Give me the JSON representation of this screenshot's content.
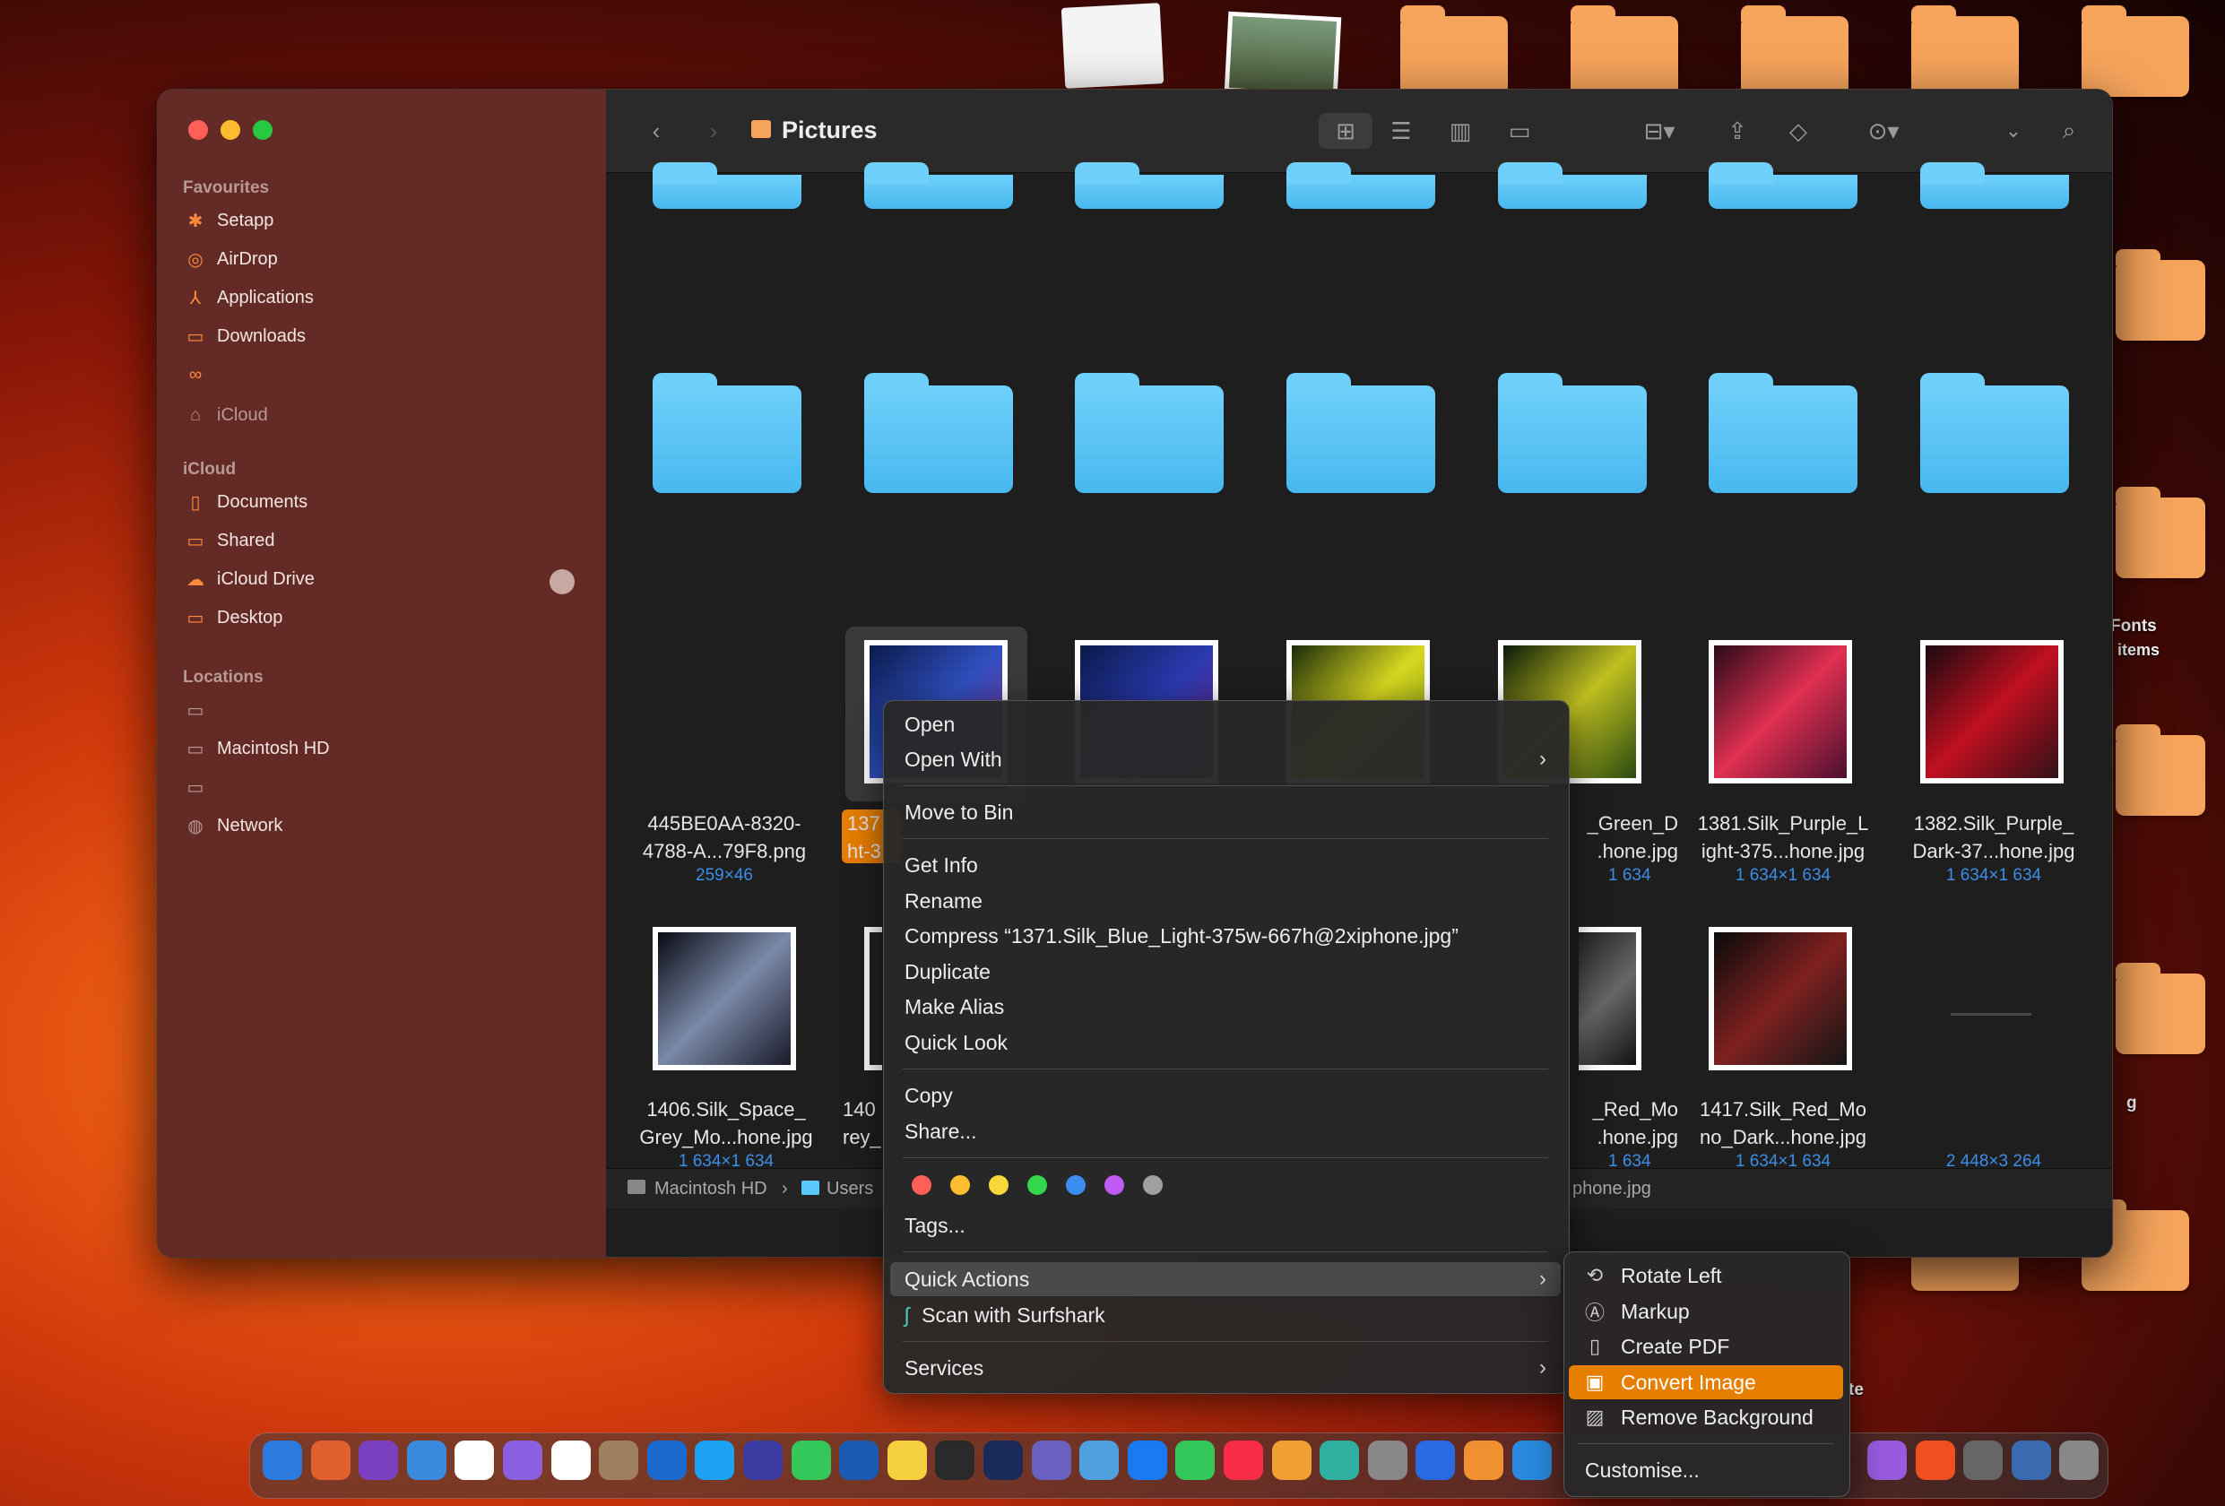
{
  "window": {
    "title": "Pictures"
  },
  "sidebar": {
    "favourites_header": "Favourites",
    "favourites": [
      {
        "label": "Setapp",
        "icon": "setapp-icon"
      },
      {
        "label": "AirDrop",
        "icon": "airdrop-icon"
      },
      {
        "label": "Applications",
        "icon": "applications-icon"
      },
      {
        "label": "Downloads",
        "icon": "downloads-icon"
      }
    ],
    "icloud_item": "iCloud",
    "icloud_header": "iCloud",
    "icloud": [
      {
        "label": "Documents",
        "icon": "document-icon"
      },
      {
        "label": "Shared",
        "icon": "shared-folder-icon"
      },
      {
        "label": "iCloud Drive",
        "icon": "cloud-icon"
      },
      {
        "label": "Desktop",
        "icon": "desktop-icon"
      }
    ],
    "locations_header": "Locations",
    "locations": [
      {
        "label": "",
        "icon": "computer-icon"
      },
      {
        "label": "Macintosh HD",
        "icon": "disk-icon"
      },
      {
        "label": "",
        "icon": "drive-icon"
      },
      {
        "label": "Network",
        "icon": "network-icon"
      }
    ]
  },
  "files": [
    {
      "name": "445BE0AA-8320-4788-A...79F8.png",
      "dims": "259×46"
    },
    {
      "name": "137",
      "name2": "ht-3",
      "dims": ""
    },
    {
      "name": "_Green_D",
      "name2": ".hone.jpg",
      "dims": "1 634"
    },
    {
      "name": "1381.Silk_Purple_L",
      "name2": "ight-375...hone.jpg",
      "dims": "1 634×1 634"
    },
    {
      "name": "1382.Silk_Purple_",
      "name2": "Dark-37...hone.jpg",
      "dims": "1 634×1 634"
    },
    {
      "name": "1406.Silk_Space_",
      "name2": "Grey_Mo...hone.jpg",
      "dims": "1 634×1 634"
    },
    {
      "name": "140",
      "name2": "rey_",
      "dims": ""
    },
    {
      "name": "_Red_Mo",
      "name2": ".hone.jpg",
      "dims": "1 634"
    },
    {
      "name": "1417.Silk_Red_Mo",
      "name2": "no_Dark...hone.jpg",
      "dims": "1 634×1 634"
    },
    {
      "name": "",
      "name2": "",
      "dims": "2 448×3 264"
    }
  ],
  "pathbar": {
    "items": [
      "Macintosh HD",
      "Users"
    ],
    "tail": "phone.jpg"
  },
  "context_menu": {
    "open": "Open",
    "open_with": "Open With",
    "move_to_bin": "Move to Bin",
    "get_info": "Get Info",
    "rename": "Rename",
    "compress": "Compress “1371.Silk_Blue_Light-375w-667h@2xiphone.jpg”",
    "duplicate": "Duplicate",
    "make_alias": "Make Alias",
    "quick_look": "Quick Look",
    "copy": "Copy",
    "share": "Share...",
    "tags": "Tags...",
    "quick_actions": "Quick Actions",
    "scan": "Scan with Surfshark",
    "services": "Services",
    "tag_colors": [
      "#ff5f57",
      "#febc2e",
      "#f7d83a",
      "#32d74b",
      "#3b8ef0",
      "#bf5af2",
      "#a0a0a0"
    ]
  },
  "submenu": {
    "rotate_left": "Rotate Left",
    "markup": "Markup",
    "create_pdf": "Create PDF",
    "convert_image": "Convert Image",
    "remove_background": "Remove Background",
    "customise": "Customise..."
  },
  "desktop": {
    "label_fonts": "Fonts",
    "label_items": "items",
    "label_g": "g",
    "label_te": "te"
  },
  "colors": {
    "accent": "#e67e00",
    "folder_blue": "#5ac8fa"
  }
}
